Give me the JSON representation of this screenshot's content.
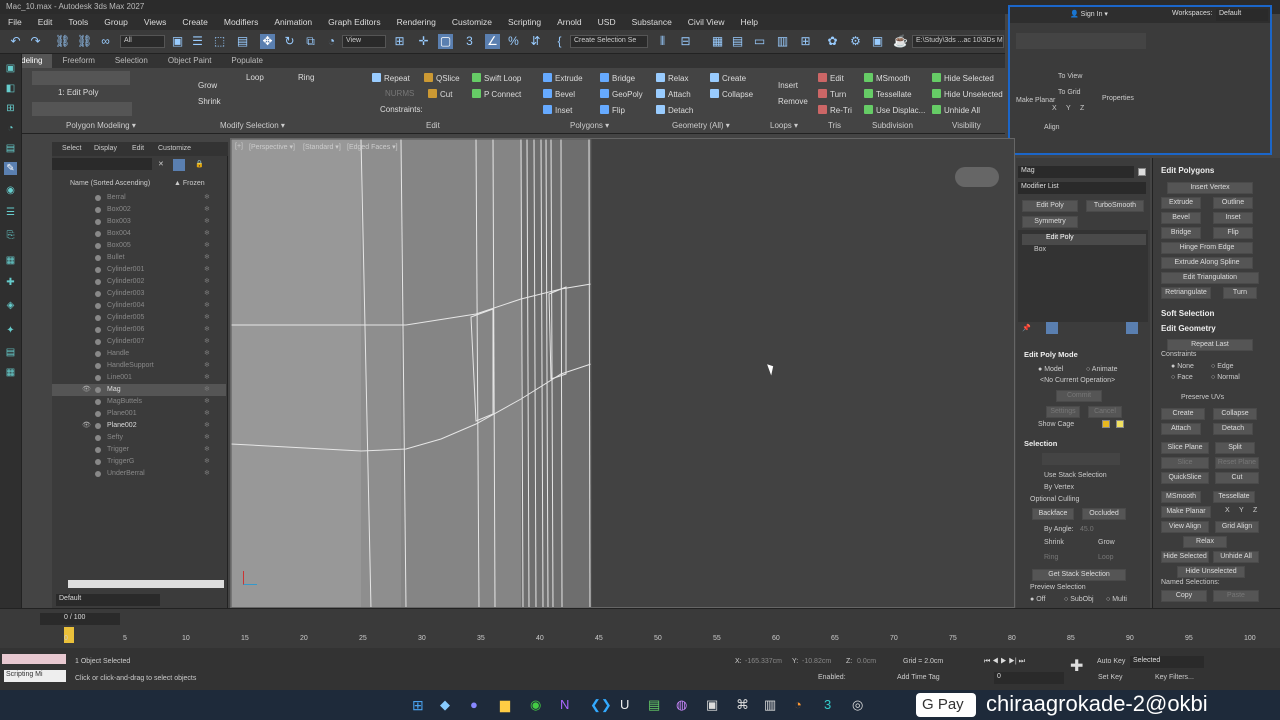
{
  "window_title": "Mac_10.max - Autodesk 3ds Max 2027",
  "menu": [
    "File",
    "Edit",
    "Tools",
    "Group",
    "Views",
    "Create",
    "Modifiers",
    "Animation",
    "Graph Editors",
    "Rendering",
    "Customize",
    "Scripting",
    "Arnold",
    "USD",
    "Substance",
    "Civil View",
    "Help"
  ],
  "toolbar": {
    "filter_value": "All",
    "view_value": "View",
    "selection_set_placeholder": "Create Selection Se",
    "path_value": "E:\\Study\\3ds ...ac 10\\3Ds M"
  },
  "ribbon_tabs": [
    "Modeling",
    "Freeform",
    "Selection",
    "Object Paint",
    "Populate"
  ],
  "ribbon": {
    "mode_label": "1: Edit Poly",
    "grow": "Grow",
    "shrink": "Shrink",
    "loop": "Loop",
    "ring": "Ring",
    "repeat": "Repeat",
    "qslice": "QSlice",
    "swift_loop": "Swift Loop",
    "cut": "Cut",
    "p_connect": "P Connect",
    "constraints": "Constraints:",
    "nurms": "NURMS",
    "extrude": "Extrude",
    "bevel": "Bevel",
    "inset": "Inset",
    "bridge": "Bridge",
    "geopoly": "GeoPoly",
    "flip": "Flip",
    "relax": "Relax",
    "create": "Create",
    "attach": "Attach",
    "collapse": "Collapse",
    "detach": "Detach",
    "insert": "Insert",
    "remove": "Remove",
    "edit": "Edit",
    "turn": "Turn",
    "retri": "Re-Tri",
    "msmooth": "MSmooth",
    "tessellate": "Tessellate",
    "use_displac": "Use Displac...",
    "hide_selected": "Hide Selected",
    "hide_unselected": "Hide Unselected",
    "unhide_all": "Unhide All",
    "groups": [
      "Polygon Modeling ▾",
      "Modify Selection ▾",
      "Edit",
      "Polygons ▾",
      "Geometry (All) ▾",
      "Loops ▾",
      "Tris",
      "Subdivision",
      "Visibility"
    ]
  },
  "workspace": {
    "sign_in": "Sign In",
    "workspaces_label": "Workspaces:",
    "workspace_value": "Default",
    "to_view": "To View",
    "to_grid": "To Grid",
    "make_planar": "Make Planar",
    "xyz": [
      "X",
      "Y",
      "Z"
    ],
    "properties": "Properties",
    "align": "Align"
  },
  "scene_explorer": {
    "tabs": [
      "Select",
      "Display",
      "Edit",
      "Customize"
    ],
    "col_name": "Name (Sorted Ascending)",
    "col_frozen": "▲ Frozen",
    "items": [
      {
        "name": "Berral",
        "vis": false
      },
      {
        "name": "Box002",
        "vis": false
      },
      {
        "name": "Box003",
        "vis": false
      },
      {
        "name": "Box004",
        "vis": false
      },
      {
        "name": "Box005",
        "vis": false
      },
      {
        "name": "Bullet",
        "vis": false
      },
      {
        "name": "Cylinder001",
        "vis": false
      },
      {
        "name": "Cylinder002",
        "vis": false
      },
      {
        "name": "Cylinder003",
        "vis": false
      },
      {
        "name": "Cylinder004",
        "vis": false
      },
      {
        "name": "Cylinder005",
        "vis": false
      },
      {
        "name": "Cylinder006",
        "vis": false
      },
      {
        "name": "Cylinder007",
        "vis": false
      },
      {
        "name": "Handle",
        "vis": false
      },
      {
        "name": "HandleSupport",
        "vis": false
      },
      {
        "name": "Line001",
        "vis": false
      },
      {
        "name": "Mag",
        "vis": true,
        "sel": true
      },
      {
        "name": "MagButtels",
        "vis": false
      },
      {
        "name": "Plane001",
        "vis": false
      },
      {
        "name": "Plane002",
        "vis": true
      },
      {
        "name": "Sefty",
        "vis": false
      },
      {
        "name": "Trigger",
        "vis": false
      },
      {
        "name": "TriggerG",
        "vis": false
      },
      {
        "name": "UnderBerral",
        "vis": false
      }
    ],
    "layer_value": "Default"
  },
  "viewport": {
    "labels": [
      "[+]",
      "[Perspective ▾]",
      "[Standard ▾]",
      "[Edged Faces ▾]"
    ]
  },
  "command_panel": {
    "object_name": "Mag",
    "modifier_list": "Modifier List",
    "buttons": [
      "Edit Poly",
      "TurboSmooth",
      "Symmetry"
    ],
    "stack": [
      "Edit Poly",
      "Box"
    ],
    "edit_poly_mode": "Edit Poly Mode",
    "model": "Model",
    "animate": "Animate",
    "no_op": "<No Current Operation>",
    "commit": "Commit",
    "settings": "Settings",
    "cancel": "Cancel",
    "show_cage": "Show Cage",
    "selection": "Selection",
    "use_stack": "Use Stack Selection",
    "by_vertex": "By Vertex",
    "optional_culling": "Optional Culling",
    "backface": "Backface",
    "occluded": "Occluded",
    "by_angle": "By Angle:",
    "angle_value": "45.0",
    "shrink": "Shrink",
    "grow": "Grow",
    "ring": "Ring",
    "loop": "Loop",
    "get_stack": "Get Stack Selection",
    "preview_selection": "Preview Selection",
    "off": "Off",
    "subobj": "SubObj",
    "multi": "Multi"
  },
  "right_rollout": {
    "edit_polygons": "Edit Polygons",
    "insert_vertex": "Insert Vertex",
    "extrude": "Extrude",
    "outline": "Outline",
    "bevel": "Bevel",
    "inset": "Inset",
    "bridge": "Bridge",
    "flip": "Flip",
    "hinge": "Hinge From Edge",
    "extrude_spline": "Extrude Along Spline",
    "edit_tri": "Edit Triangulation",
    "retriangulate": "Retriangulate",
    "turn": "Turn",
    "soft_selection": "Soft Selection",
    "edit_geometry": "Edit Geometry",
    "repeat_last": "Repeat Last",
    "constraints": "Constraints",
    "none": "None",
    "edge": "Edge",
    "face": "Face",
    "normal": "Normal",
    "preserve_uvs": "Preserve UVs",
    "create": "Create",
    "collapse": "Collapse",
    "attach": "Attach",
    "detach": "Detach",
    "slice_plane": "Slice Plane",
    "split": "Split",
    "slice": "Slice",
    "reset_plane": "Reset Plane",
    "quickslice": "QuickSlice",
    "cut": "Cut",
    "msmooth": "MSmooth",
    "tessellate": "Tessellate",
    "make_planar": "Make Planar",
    "x": "X",
    "y": "Y",
    "z": "Z",
    "view_align": "View Align",
    "grid_align": "Grid Align",
    "relax": "Relax",
    "hide_selected": "Hide Selected",
    "unhide_all": "Unhide All",
    "hide_unselected": "Hide Unselected",
    "named_selections": "Named Selections:",
    "copy": "Copy",
    "paste": "Paste"
  },
  "timeline": {
    "frame_label": "0 / 100",
    "ticks": [
      "0",
      "5",
      "10",
      "15",
      "20",
      "25",
      "30",
      "35",
      "40",
      "45",
      "50",
      "55",
      "60",
      "65",
      "70",
      "75",
      "80",
      "85",
      "90",
      "95",
      "100"
    ]
  },
  "status": {
    "maxscript": "Scripting Mi",
    "objects_selected": "1 Object Selected",
    "hint": "Click or click-and-drag to select objects",
    "x_label": "X:",
    "x_value": "-165.337cm",
    "y_label": "Y:",
    "y_value": "-10.82cm",
    "z_label": "Z:",
    "z_value": "0.0cm",
    "grid": "Grid = 2.0cm",
    "enabled": "Enabled:",
    "add_time_tag": "Add Time Tag",
    "auto_key": "Auto Key",
    "set_key": "Set Key",
    "selected": "Selected",
    "key_filters": "Key Filters...",
    "frame_value": "0"
  },
  "overlay": {
    "gpay": "G Pay",
    "upi": "chiraagrokade-2@okbi"
  }
}
